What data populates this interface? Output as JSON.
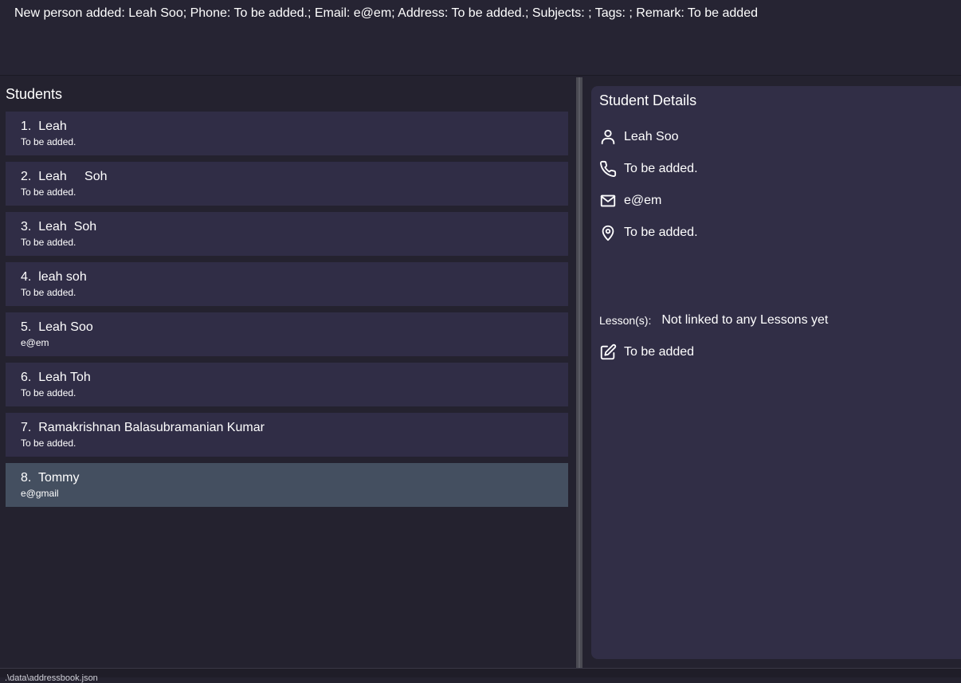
{
  "result": {
    "message": "New person added: Leah Soo; Phone: To be added.; Email: e@em; Address: To be added.; Subjects: ; Tags: ; Remark: To be added"
  },
  "student_list": {
    "title": "Students",
    "items": [
      {
        "name": "1.  Leah",
        "sub": "To be added."
      },
      {
        "name": "2.  Leah     Soh",
        "sub": "To be added."
      },
      {
        "name": "3.  Leah  Soh",
        "sub": "To be added."
      },
      {
        "name": "4.  leah soh",
        "sub": "To be added."
      },
      {
        "name": "5.  Leah Soo",
        "sub": "e@em"
      },
      {
        "name": "6.  Leah Toh",
        "sub": "To be added."
      },
      {
        "name": "7.  Ramakrishnan Balasubramanian Kumar",
        "sub": "To be added."
      },
      {
        "name": "8.  Tommy",
        "sub": "e@gmail",
        "selected": true
      }
    ]
  },
  "details": {
    "title": "Student Details",
    "name": "Leah Soo",
    "phone": "To be added.",
    "email": "e@em",
    "address": "To be added.",
    "lessons_label": "Lesson(s):",
    "lessons_value": "Not linked to any Lessons yet",
    "remark": "To be added"
  },
  "icons": {
    "name": "person-icon",
    "phone": "phone-icon",
    "email": "mail-icon",
    "address": "location-pin-icon",
    "remark": "edit-icon"
  },
  "colors": {
    "background": "#24222f",
    "card": "#302d46",
    "card_selected": "#444f60",
    "details_panel": "#312e46"
  },
  "status": {
    "text": ".\\data\\addressbook.json"
  }
}
